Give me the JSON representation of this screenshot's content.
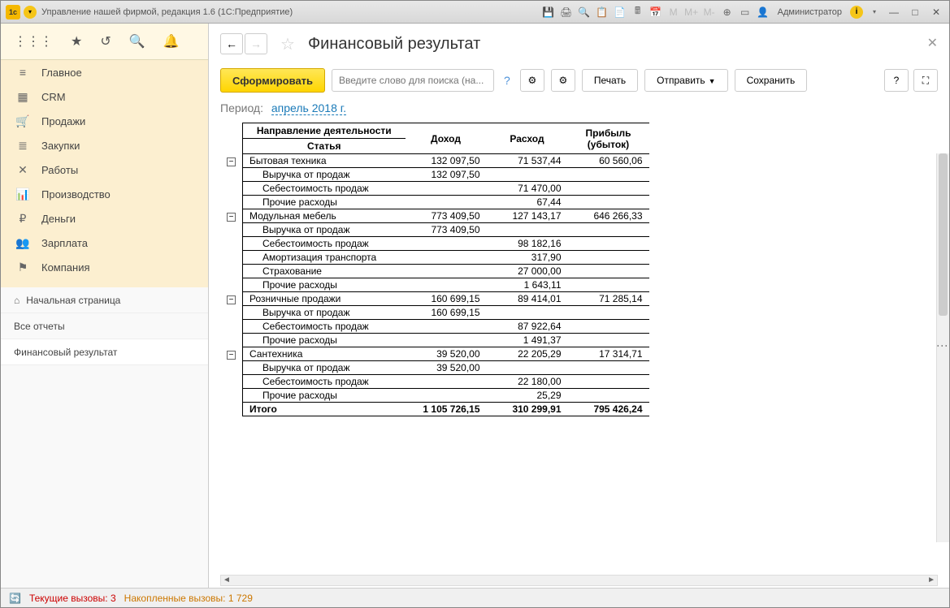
{
  "titlebar": {
    "title": "Управление нашей фирмой, редакция 1.6  (1С:Предприятие)",
    "admin": "Администратор"
  },
  "sidebar": {
    "items": [
      {
        "icon": "≡",
        "label": "Главное"
      },
      {
        "icon": "▦",
        "label": "CRM"
      },
      {
        "icon": "🛒",
        "label": "Продажи"
      },
      {
        "icon": "≣",
        "label": "Закупки"
      },
      {
        "icon": "✕",
        "label": "Работы"
      },
      {
        "icon": "📊",
        "label": "Производство"
      },
      {
        "icon": "₽",
        "label": "Деньги"
      },
      {
        "icon": "👥",
        "label": "Зарплата"
      },
      {
        "icon": "⚑",
        "label": "Компания"
      }
    ],
    "subs": [
      {
        "label": "Начальная страница",
        "home": true
      },
      {
        "label": "Все отчеты"
      },
      {
        "label": "Финансовый результат",
        "active": true
      }
    ]
  },
  "page": {
    "title": "Финансовый результат",
    "generate": "Сформировать",
    "searchPlaceholder": "Введите слово для поиска (на...",
    "print": "Печать",
    "send": "Отправить",
    "save": "Сохранить",
    "periodLabel": "Период:",
    "periodValue": "апрель 2018 г."
  },
  "report": {
    "headers": {
      "activity": "Направление деятельности",
      "article": "Статья",
      "income": "Доход",
      "expense": "Расход",
      "profit": "Прибыль (убыток)"
    },
    "groups": [
      {
        "name": "Бытовая техника",
        "income": "132 097,50",
        "expense": "71 537,44",
        "profit": "60 560,06",
        "rows": [
          {
            "name": "Выручка от продаж",
            "income": "132 097,50"
          },
          {
            "name": "Себестоимость продаж",
            "expense": "71 470,00"
          },
          {
            "name": "Прочие расходы",
            "expense": "67,44"
          }
        ]
      },
      {
        "name": "Модульная мебель",
        "income": "773 409,50",
        "expense": "127 143,17",
        "profit": "646 266,33",
        "rows": [
          {
            "name": "Выручка от продаж",
            "income": "773 409,50"
          },
          {
            "name": "Себестоимость продаж",
            "expense": "98 182,16"
          },
          {
            "name": "Амортизация транспорта",
            "expense": "317,90"
          },
          {
            "name": "Страхование",
            "expense": "27 000,00"
          },
          {
            "name": "Прочие расходы",
            "expense": "1 643,11"
          }
        ]
      },
      {
        "name": "Розничные продажи",
        "income": "160 699,15",
        "expense": "89 414,01",
        "profit": "71 285,14",
        "rows": [
          {
            "name": "Выручка от продаж",
            "income": "160 699,15"
          },
          {
            "name": "Себестоимость продаж",
            "expense": "87 922,64"
          },
          {
            "name": "Прочие расходы",
            "expense": "1 491,37"
          }
        ]
      },
      {
        "name": "Сантехника",
        "income": "39 520,00",
        "expense": "22 205,29",
        "profit": "17 314,71",
        "rows": [
          {
            "name": "Выручка от продаж",
            "income": "39 520,00"
          },
          {
            "name": "Себестоимость продаж",
            "expense": "22 180,00"
          },
          {
            "name": "Прочие расходы",
            "expense": "25,29"
          }
        ]
      }
    ],
    "total": {
      "label": "Итого",
      "income": "1 105 726,15",
      "expense": "310 299,91",
      "profit": "795 426,24"
    }
  },
  "status": {
    "s1label": "Текущие вызовы:",
    "s1val": "3",
    "s2label": "Накопленные вызовы:",
    "s2val": "1 729"
  }
}
